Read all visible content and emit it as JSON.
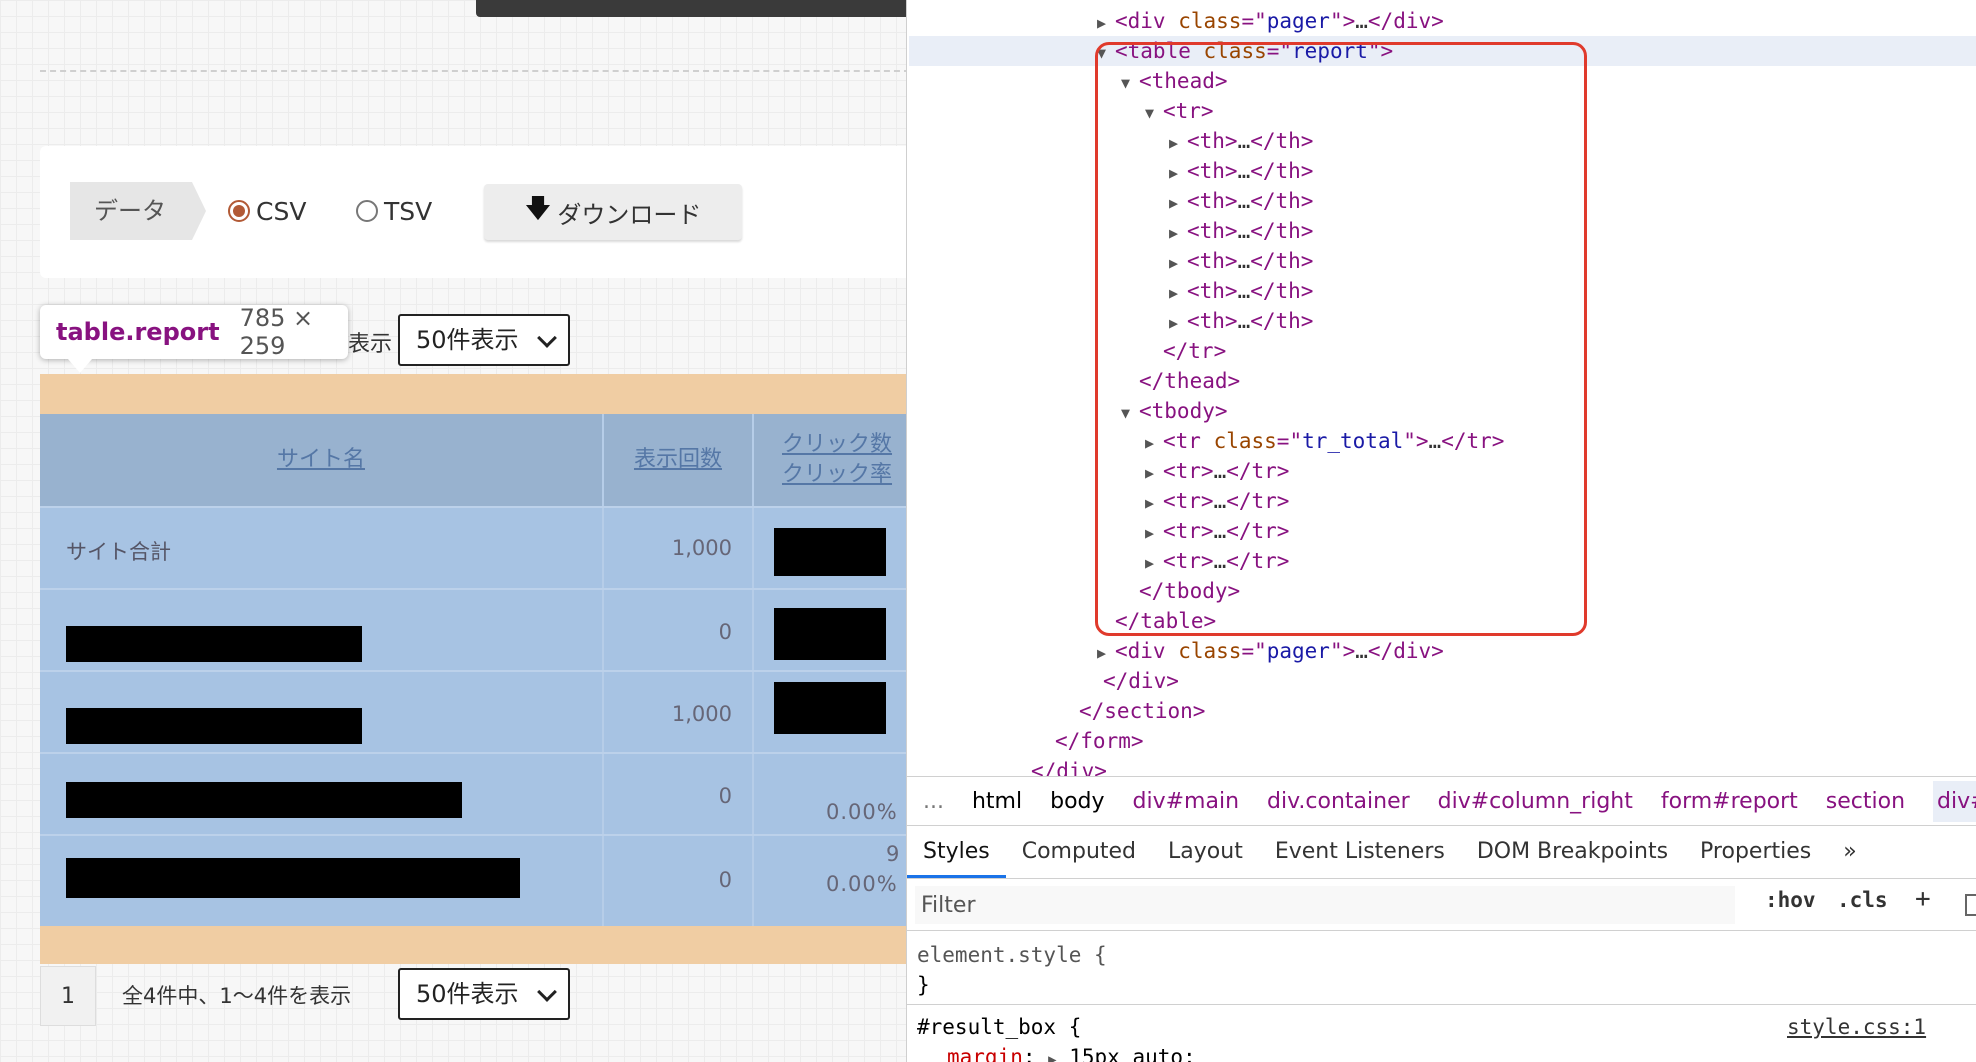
{
  "download_panel": {
    "data_label": "データ",
    "radio_csv": "CSV",
    "radio_tsv": "TSV",
    "selected_format": "CSV",
    "download_button": "ダウンロード"
  },
  "tooltip": {
    "selector": "table.report",
    "size": "785 × 259"
  },
  "pager_top": {
    "label_fragment": "表示",
    "per_page": "50件表示"
  },
  "report_table": {
    "headers": [
      "サイト名",
      "表示回数",
      "クリック数",
      "クリック率"
    ],
    "rows": [
      {
        "name": "サイト合計",
        "impressions": "1,000"
      },
      {
        "name": "",
        "impressions": "0"
      },
      {
        "name": "",
        "impressions": "1,000"
      },
      {
        "name": "",
        "impressions": "0",
        "rate": "0.00%"
      },
      {
        "name": "",
        "impressions": "0",
        "clicks": "9",
        "rate": "0.00%"
      }
    ]
  },
  "pager_bottom": {
    "page": "1",
    "summary": "全4件中、1〜4件を表示",
    "per_page": "50件表示"
  },
  "devtools": {
    "dom_lines": [
      {
        "text_parts": [
          "div",
          "class",
          "pager"
        ],
        "kind": "collapsed-div"
      },
      {
        "kind": "table-open"
      }
    ],
    "breadcrumbs": [
      "...",
      "html",
      "body",
      "div#main",
      "div.container",
      "div#column_right",
      "form#report",
      "section",
      "div#re"
    ],
    "tabs": [
      "Styles",
      "Computed",
      "Layout",
      "Event Listeners",
      "DOM Breakpoints",
      "Properties",
      "»"
    ],
    "active_tab": "Styles",
    "filter_placeholder": "Filter",
    "filter_buttons": [
      ":hov",
      ".cls",
      "+"
    ],
    "styles": {
      "element_style": "element.style {",
      "close_brace": "}",
      "rule_selector": "#result_box {",
      "rule_source": "style.css:1",
      "rule_prop": "margin",
      "rule_value": "15px auto;"
    }
  },
  "colors": {
    "highlight_border": "#e03a2c",
    "table_bg": "#a7c3e3",
    "orange_band": "#f0cda3"
  }
}
